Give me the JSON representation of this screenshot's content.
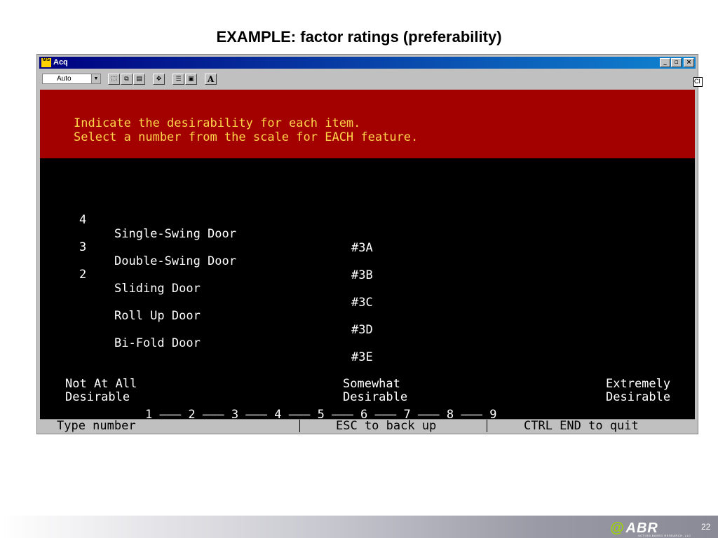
{
  "slide": {
    "title": "EXAMPLE:  factor ratings (preferability)",
    "page_number": "22"
  },
  "window": {
    "app_title": "Acq",
    "icon_text": "MS",
    "buttons": {
      "minimize": "_",
      "restore": "▫",
      "close": "×"
    }
  },
  "toolbar": {
    "font_value": "Auto",
    "bold_label": "A",
    "clip_label": "Cl"
  },
  "banner": {
    "line1": "Indicate the desirability for each item.",
    "line2": "Select a number from the scale for EACH feature."
  },
  "items": [
    {
      "rating": "4",
      "name": "Single-Swing Door",
      "code": "#3A"
    },
    {
      "rating": "3",
      "name": "Double-Swing Door",
      "code": "#3B"
    },
    {
      "rating": "2",
      "name": "Sliding Door",
      "code": "#3C"
    },
    {
      "rating": "",
      "name": "Roll Up Door",
      "code": "#3D"
    },
    {
      "rating": "",
      "name": "Bi-Fold Door",
      "code": "#3E"
    }
  ],
  "scale": {
    "low_line1": "Not At All",
    "low_line2": "Desirable",
    "mid_line1": "Somewhat",
    "mid_line2": "Desirable",
    "high_line1": "Extremely",
    "high_line2": "Desirable",
    "line": "1 ——— 2 ——— 3 ——— 4 ——— 5 ——— 6 ——— 7 ——— 8 ——— 9"
  },
  "status": {
    "left": "Type number",
    "middle": "ESC to back up",
    "right": "CTRL END to quit"
  },
  "footer": {
    "logo_text": "ABR",
    "logo_sub": "ACTION BASED RESEARCH, LLC"
  },
  "colors": {
    "banner": "#a30000",
    "banner_text": "#ffd54a",
    "screen": "#000000",
    "titlebar": "#000080"
  }
}
